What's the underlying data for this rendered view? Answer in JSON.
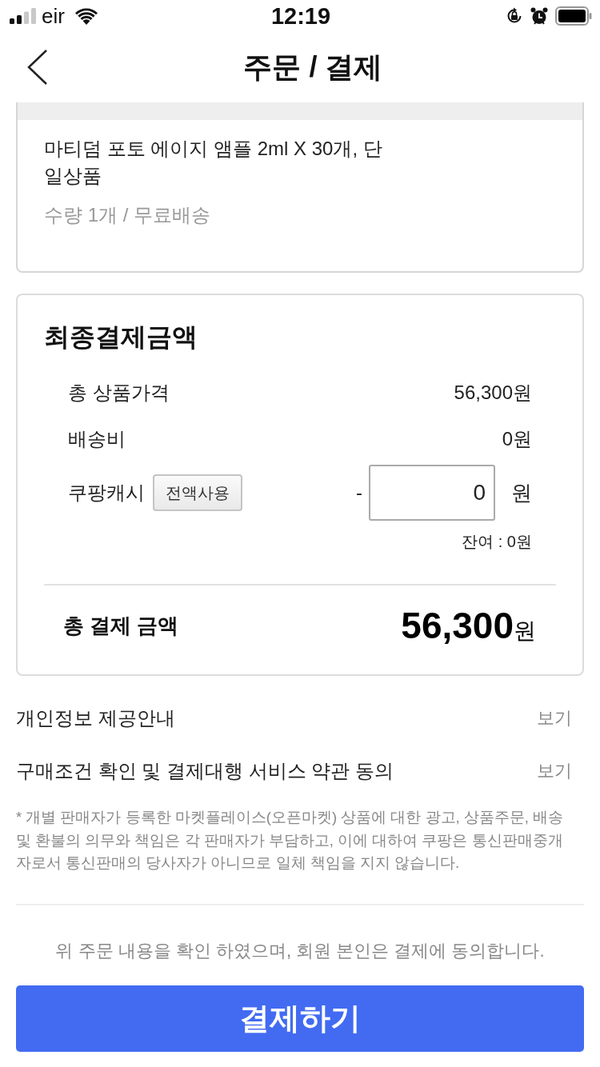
{
  "status_bar": {
    "carrier": "eir",
    "time": "12:19"
  },
  "nav": {
    "title": "주문 / 결제"
  },
  "product": {
    "name": "마티덤 포토 에이지 앰플 2ml X 30개, 단일상품",
    "detail": "수량 1개 / 무료배송"
  },
  "payment": {
    "title": "최종결제금액",
    "rows": [
      {
        "kind": "amount",
        "label": "총 상품가격",
        "value": "56,300원"
      },
      {
        "kind": "amount",
        "label": "배송비",
        "value": "0원"
      },
      {
        "kind": "cash",
        "label": "쿠팡캐시",
        "button": "전액사용",
        "sign": "-",
        "input_value": "0",
        "unit": "원",
        "note": "잔여 : 0원"
      }
    ],
    "total": {
      "label": "총 결제 금액",
      "amount": "56,300",
      "unit": "원"
    }
  },
  "terms": [
    {
      "label": "개인정보 제공안내",
      "action": "보기"
    },
    {
      "label": "구매조건 확인 및 결제대행 서비스 약관 동의",
      "action": "보기"
    }
  ],
  "disclaimer": "* 개별 판매자가 등록한 마켓플레이스(오픈마켓) 상품에 대한 광고, 상품주문, 배송 및 환불의 의무와 책임은 각 판매자가 부담하고, 이에 대하여 쿠팡은 통신판매중개자로서 통신판매의 당사자가 아니므로 일체 책임을 지지 않습니다.",
  "agreement": "위 주문 내용을 확인 하였으며, 회원 본인은 결제에 동의합니다.",
  "pay_button": "결제하기"
}
